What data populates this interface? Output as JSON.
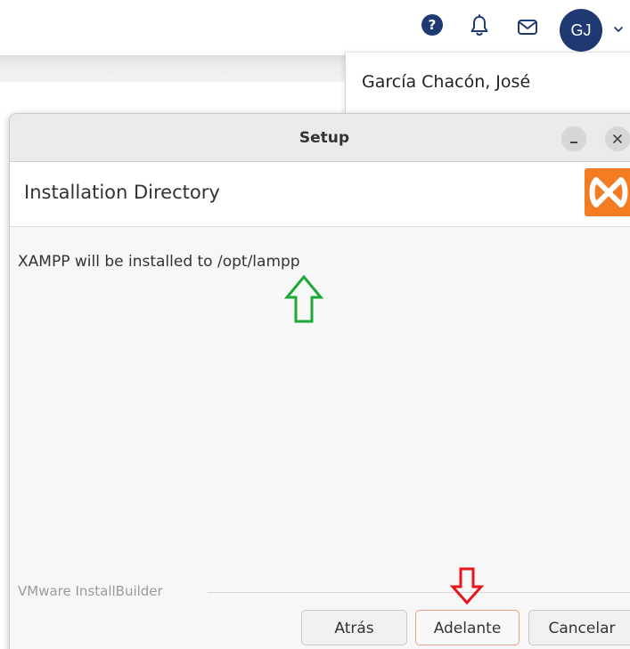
{
  "topbar": {
    "help_icon": "question-circle-icon",
    "help_glyph": "?",
    "notifications_icon": "bell-icon",
    "messages_icon": "envelope-icon",
    "avatar_initials": "GJ",
    "dropdown_icon": "chevron-down-icon",
    "accent_color": "#1f3a73"
  },
  "user_menu": {
    "name": "García Chacón, José"
  },
  "dialog": {
    "title": "Setup",
    "minimize_icon": "minimize-icon",
    "close_icon": "close-icon",
    "page_title": "Installation Directory",
    "logo_icon": "xampp-logo-icon",
    "logo_color": "#f37b22",
    "message": "XAMPP will be installed to /opt/lampp",
    "branding": "VMware InstallBuilder",
    "annotations": {
      "green_arrow": "up-arrow-icon",
      "green_color": "#1ea838",
      "red_arrow": "down-arrow-icon",
      "red_color": "#e8151b"
    },
    "buttons": {
      "back": "Atrás",
      "next": "Adelante",
      "cancel": "Cancelar"
    }
  }
}
